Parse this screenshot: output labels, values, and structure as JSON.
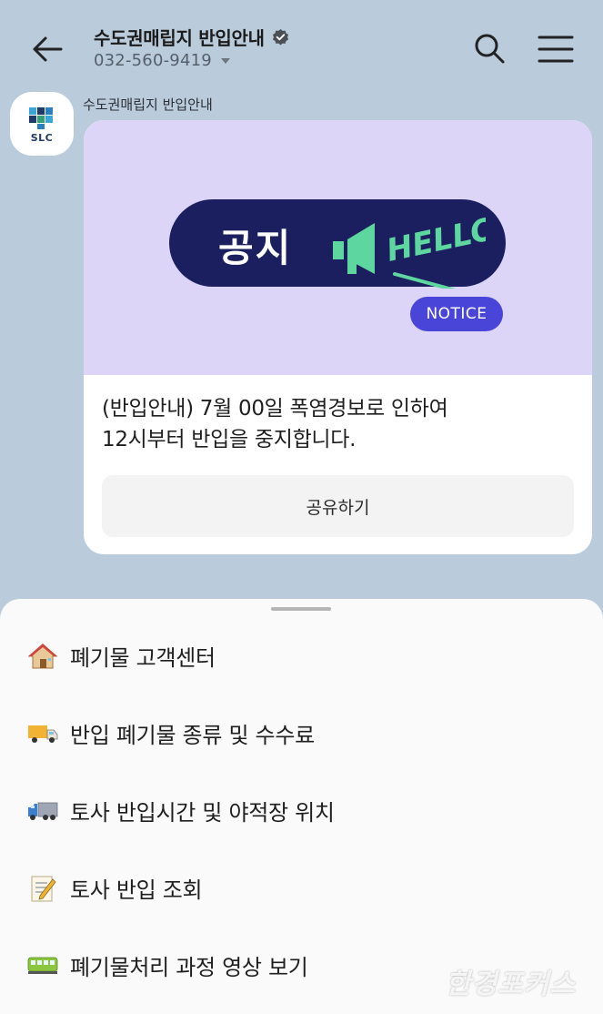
{
  "header": {
    "title": "수도권매립지 반입안내",
    "phone": "032-560-9419"
  },
  "chat": {
    "sender_name": "수도권매립지 반입안내",
    "avatar_text": "SLC",
    "banner": {
      "pill_text": "공지",
      "hello_text": "HELLO!",
      "notice_label": "NOTICE"
    },
    "message_line1": "(반입안내) 7월 00일 폭염경보로 인하여",
    "message_line2": "12시부터 반입을 중지합니다.",
    "share_label": "공유하기",
    "colors": {
      "banner_bg": "#dcd5f7",
      "pill_bg": "#1b1f5f",
      "notice_bg": "#4a45d9",
      "megaphone": "#5ed6a0"
    }
  },
  "menu": {
    "items": [
      {
        "icon": "house-icon",
        "label": "폐기물 고객센터"
      },
      {
        "icon": "delivery-truck-icon",
        "label": "반입 폐기물 종류 및 수수료"
      },
      {
        "icon": "lorry-icon",
        "label": "토사 반입시간 및 야적장 위치"
      },
      {
        "icon": "memo-icon",
        "label": "토사 반입 조회"
      },
      {
        "icon": "train-icon",
        "label": "폐기물처리 과정 영상 보기"
      }
    ]
  },
  "watermark": "한경포커스"
}
